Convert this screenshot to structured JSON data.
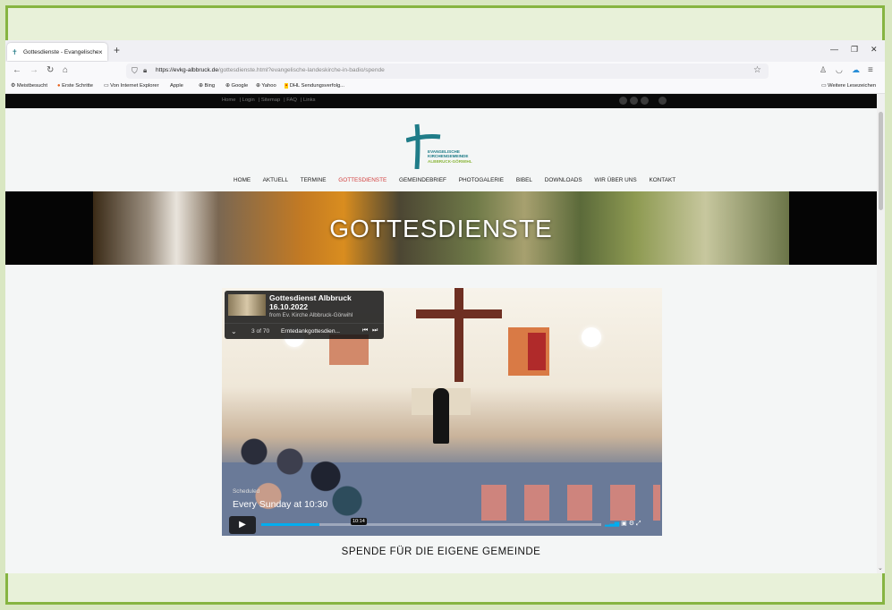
{
  "browser": {
    "tab_title": "Gottesdienste - Evangelische Ki",
    "tab_close": "×",
    "new_tab": "+",
    "url_host": "https://evkg-albbruck.de",
    "url_path": "/gottesdienste.html?evangelische-landeskirche-in-badio/spende",
    "bookmarks": [
      "Meistbesucht",
      "Erste Schritte",
      "Von Internet Explorer",
      "Apple",
      "Bing",
      "Google",
      "Yahoo",
      "DHL Sendungsverfolg..."
    ],
    "other_bookmarks": "Weitere Lesezeichen"
  },
  "site": {
    "top_links": [
      "Home",
      "Login",
      "Sitemap",
      "FAQ",
      "Links"
    ],
    "logo_line1": "EVANGELISCHE",
    "logo_line2": "KIRCHENGEMEINDE",
    "logo_line3": "ALBBRUCK-GÖRWIHL",
    "menu": [
      "HOME",
      "AKTUELL",
      "TERMINE",
      "GOTTESDIENSTE",
      "GEMEINDEBRIEF",
      "PHOTOGALERIE",
      "BIBEL",
      "DOWNLOADS",
      "WIR ÜBER UNS",
      "KONTAKT"
    ],
    "active_menu": "GOTTESDIENSTE",
    "hero_title": "GOTTESDIENSTE",
    "section_heading": "SPENDE FÜR DIE EIGENE GEMEINDE"
  },
  "video": {
    "title_line1": "Gottesdienst Albbruck",
    "title_line2": "16.10.2022",
    "from": "from Ev. Kirche Albbruck-Görwihl",
    "playlist_pos": "3 of 70",
    "playlist_item": "Erntedankgottesdien...",
    "status": "Scheduled",
    "schedule": "Every Sunday at 10:30",
    "time_tooltip": "10:14",
    "progress_fraction": 0.17
  },
  "colors": {
    "frame_green": "#86b441",
    "logo_teal": "#1f7c88",
    "active_red": "#d2403f",
    "progress_blue": "#00adef"
  }
}
